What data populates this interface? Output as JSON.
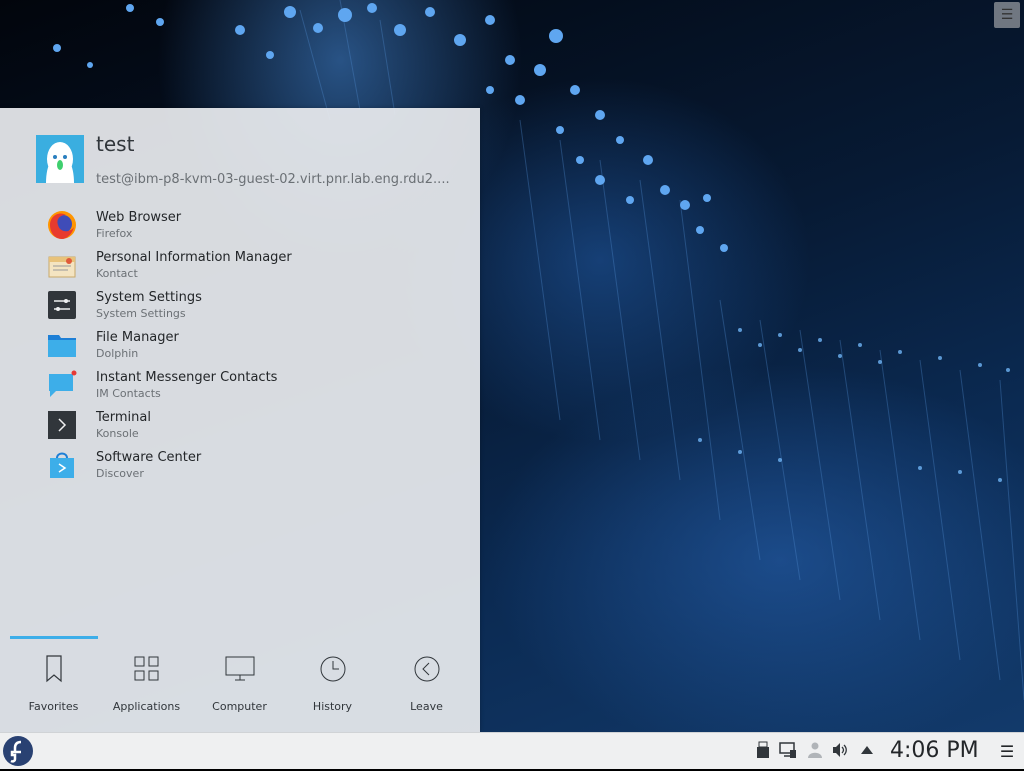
{
  "user": {
    "name": "test",
    "host": "test@ibm-p8-kvm-03-guest-02.virt.pnr.lab.eng.rdu2...."
  },
  "favorites": [
    {
      "name": "Web Browser",
      "generic": "Firefox",
      "icon": "firefox-icon"
    },
    {
      "name": "Personal Information Manager",
      "generic": "Kontact",
      "icon": "kontact-icon"
    },
    {
      "name": "System Settings",
      "generic": "System Settings",
      "icon": "system-settings-icon"
    },
    {
      "name": "File Manager",
      "generic": "Dolphin",
      "icon": "folder-icon"
    },
    {
      "name": "Instant Messenger Contacts",
      "generic": "IM Contacts",
      "icon": "chat-bubble-icon"
    },
    {
      "name": "Terminal",
      "generic": "Konsole",
      "icon": "terminal-icon"
    },
    {
      "name": "Software Center",
      "generic": "Discover",
      "icon": "shopping-bag-icon"
    }
  ],
  "tabs": [
    {
      "label": "Favorites",
      "icon": "bookmark-icon",
      "active": true
    },
    {
      "label": "Applications",
      "icon": "grid-icon"
    },
    {
      "label": "Computer",
      "icon": "monitor-icon"
    },
    {
      "label": "History",
      "icon": "clock-icon"
    },
    {
      "label": "Leave",
      "icon": "arrow-left-circle-icon"
    }
  ],
  "panel": {
    "clock": "4:06 PM",
    "tray_icons": [
      "usb-icon",
      "network-icon",
      "user-status-icon",
      "volume-icon",
      "expand-arrow-icon"
    ]
  },
  "colors": {
    "accent": "#3daee9",
    "launcher_bg": "#e8ebee",
    "panel_bg": "#eff0f1"
  }
}
